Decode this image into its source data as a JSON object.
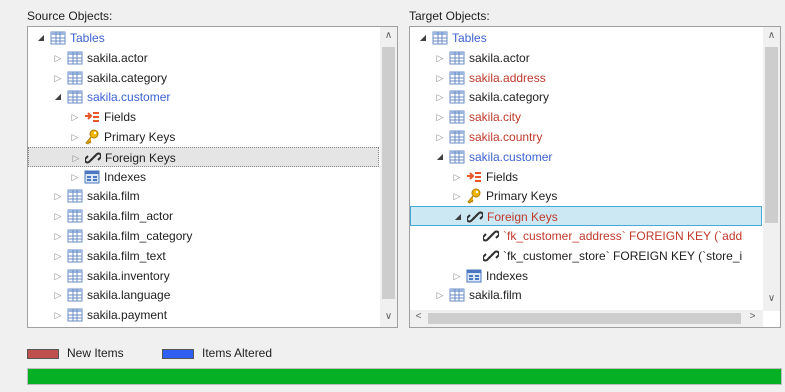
{
  "source": {
    "label": "Source Objects:",
    "rows": [
      {
        "label": "Tables",
        "color": "blue",
        "arrow": "open",
        "icon": "table-icon"
      },
      {
        "label": "sakila.actor",
        "color": "normal",
        "arrow": "closed",
        "icon": "table-icon"
      },
      {
        "label": "sakila.category",
        "color": "normal",
        "arrow": "closed",
        "icon": "table-icon"
      },
      {
        "label": "sakila.customer",
        "color": "blue",
        "arrow": "open",
        "icon": "table-icon"
      },
      {
        "label": "Fields",
        "color": "normal",
        "arrow": "closed",
        "icon": "fields-icon"
      },
      {
        "label": "Primary Keys",
        "color": "normal",
        "arrow": "closed",
        "icon": "key-icon"
      },
      {
        "label": "Foreign Keys",
        "color": "normal",
        "arrow": "closed",
        "icon": "link-icon"
      },
      {
        "label": "Indexes",
        "color": "normal",
        "arrow": "closed",
        "icon": "index-icon"
      },
      {
        "label": "sakila.film",
        "color": "normal",
        "arrow": "closed",
        "icon": "table-icon"
      },
      {
        "label": "sakila.film_actor",
        "color": "normal",
        "arrow": "closed",
        "icon": "table-icon"
      },
      {
        "label": "sakila.film_category",
        "color": "normal",
        "arrow": "closed",
        "icon": "table-icon"
      },
      {
        "label": "sakila.film_text",
        "color": "normal",
        "arrow": "closed",
        "icon": "table-icon"
      },
      {
        "label": "sakila.inventory",
        "color": "normal",
        "arrow": "closed",
        "icon": "table-icon"
      },
      {
        "label": "sakila.language",
        "color": "normal",
        "arrow": "closed",
        "icon": "table-icon"
      },
      {
        "label": "sakila.payment",
        "color": "normal",
        "arrow": "closed",
        "icon": "table-icon"
      }
    ]
  },
  "target": {
    "label": "Target Objects:",
    "rows": [
      {
        "label": "Tables",
        "color": "blue",
        "arrow": "open",
        "icon": "table-icon"
      },
      {
        "label": "sakila.actor",
        "color": "normal",
        "arrow": "closed",
        "icon": "table-icon"
      },
      {
        "label": "sakila.address",
        "color": "red",
        "arrow": "closed",
        "icon": "table-icon"
      },
      {
        "label": "sakila.category",
        "color": "normal",
        "arrow": "closed",
        "icon": "table-icon"
      },
      {
        "label": "sakila.city",
        "color": "red",
        "arrow": "closed",
        "icon": "table-icon"
      },
      {
        "label": "sakila.country",
        "color": "red",
        "arrow": "closed",
        "icon": "table-icon"
      },
      {
        "label": "sakila.customer",
        "color": "blue",
        "arrow": "open",
        "icon": "table-icon"
      },
      {
        "label": "Fields",
        "color": "normal",
        "arrow": "closed",
        "icon": "fields-icon"
      },
      {
        "label": "Primary Keys",
        "color": "normal",
        "arrow": "closed",
        "icon": "key-icon"
      },
      {
        "label": "Foreign Keys",
        "color": "red",
        "arrow": "open",
        "icon": "link-icon"
      },
      {
        "label": "`fk_customer_address` FOREIGN KEY (`add",
        "color": "red",
        "arrow": "none",
        "icon": "link-icon"
      },
      {
        "label": "`fk_customer_store` FOREIGN KEY (`store_i",
        "color": "normal",
        "arrow": "none",
        "icon": "link-icon"
      },
      {
        "label": "Indexes",
        "color": "normal",
        "arrow": "closed",
        "icon": "index-icon"
      },
      {
        "label": "sakila.film",
        "color": "normal",
        "arrow": "closed",
        "icon": "table-icon"
      }
    ]
  },
  "legend": {
    "new_label": "New Items",
    "altered_label": "Items Altered",
    "new_color": "#c0504d",
    "altered_color": "#2f5ff0"
  },
  "progress": {
    "percent": 100,
    "color": "#06b025"
  },
  "colors": {
    "blue_text": "#3b63d3",
    "red_text": "#c0392b"
  }
}
